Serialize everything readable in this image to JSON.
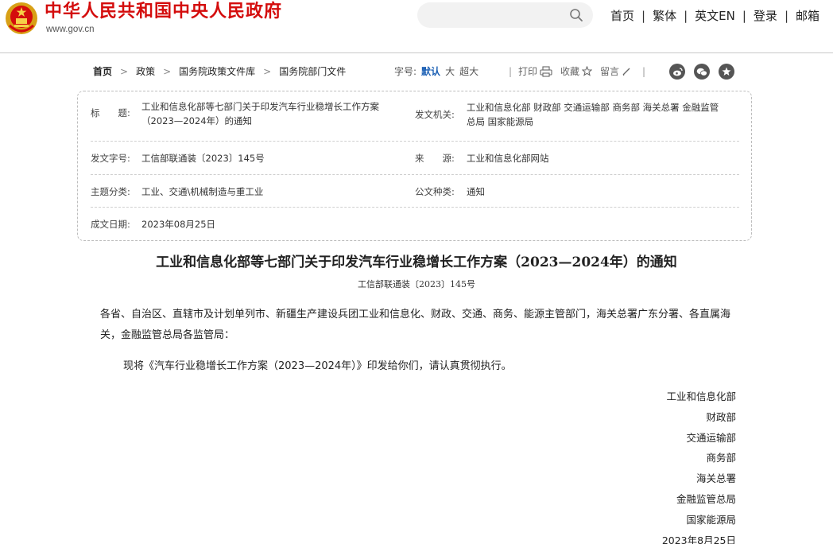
{
  "header": {
    "site_name": "中华人民共和国中央人民政府",
    "site_url": "www.gov.cn",
    "nav": [
      "首页",
      "繁体",
      "英文EN",
      "登录",
      "邮箱"
    ]
  },
  "breadcrumb": [
    "首页",
    "政策",
    "国务院政策文件库",
    "国务院部门文件"
  ],
  "font_size": {
    "label": "字号:",
    "options": [
      "默认",
      "大",
      "超大"
    ],
    "selected": "默认"
  },
  "tools": {
    "print": "打印",
    "favorite": "收藏",
    "comment": "留言"
  },
  "share_icons": [
    "weibo-icon",
    "wechat-icon",
    "qzone-icon"
  ],
  "info": {
    "title_label": "标　　题:",
    "title_value_line1": "工业和信息化部等七部门关于印发汽车行业稳增长工作方案",
    "title_value_line2": "（2023—2024年）的通知",
    "issuer_label": "发文机关:",
    "issuer_value_line1": "工业和信息化部 财政部 交通运输部 商务部 海关总署 金融监管",
    "issuer_value_line2": "总局 国家能源局",
    "doc_no_label": "发文字号:",
    "doc_no_value": "工信部联通装〔2023〕145号",
    "source_label": "来　　源:",
    "source_value": "工业和信息化部网站",
    "category_label": "主题分类:",
    "category_value": "工业、交通\\机械制造与重工业",
    "type_label": "公文种类:",
    "type_value": "通知",
    "date_label": "成文日期:",
    "date_value": "2023年08月25日"
  },
  "article": {
    "title": "工业和信息化部等七部门关于印发汽车行业稳增长工作方案（2023—2024年）的通知",
    "doc_number": "工信部联通装〔2023〕145号",
    "salutation": "各省、自治区、直辖市及计划单列市、新疆生产建设兵团工业和信息化、财政、交通、商务、能源主管部门，海关总署广东分署、各直属海关，金融监管总局各监管局：",
    "body": "现将《汽车行业稳增长工作方案（2023—2024年）》印发给你们，请认真贯彻执行。",
    "signers": [
      "工业和信息化部",
      "财政部",
      "交通运输部",
      "商务部",
      "海关总署",
      "金融监管总局",
      "国家能源局",
      "2023年8月25日"
    ]
  },
  "colors": {
    "brand_red": "#d40d0d",
    "link_blue": "#1a5fb4"
  }
}
